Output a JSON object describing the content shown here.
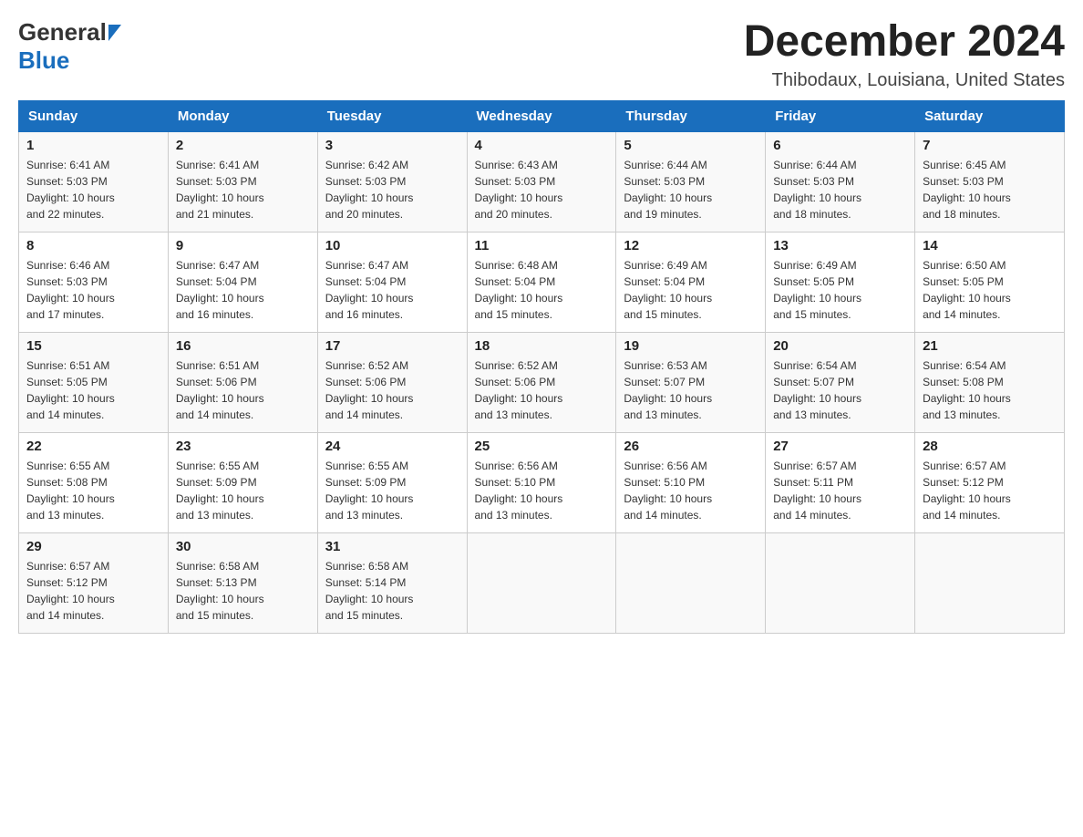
{
  "header": {
    "logo_general": "General",
    "logo_blue": "Blue",
    "month_title": "December 2024",
    "location": "Thibodaux, Louisiana, United States"
  },
  "weekdays": [
    "Sunday",
    "Monday",
    "Tuesday",
    "Wednesday",
    "Thursday",
    "Friday",
    "Saturday"
  ],
  "weeks": [
    [
      {
        "day": "1",
        "sunrise": "6:41 AM",
        "sunset": "5:03 PM",
        "daylight": "10 hours and 22 minutes."
      },
      {
        "day": "2",
        "sunrise": "6:41 AM",
        "sunset": "5:03 PM",
        "daylight": "10 hours and 21 minutes."
      },
      {
        "day": "3",
        "sunrise": "6:42 AM",
        "sunset": "5:03 PM",
        "daylight": "10 hours and 20 minutes."
      },
      {
        "day": "4",
        "sunrise": "6:43 AM",
        "sunset": "5:03 PM",
        "daylight": "10 hours and 20 minutes."
      },
      {
        "day": "5",
        "sunrise": "6:44 AM",
        "sunset": "5:03 PM",
        "daylight": "10 hours and 19 minutes."
      },
      {
        "day": "6",
        "sunrise": "6:44 AM",
        "sunset": "5:03 PM",
        "daylight": "10 hours and 18 minutes."
      },
      {
        "day": "7",
        "sunrise": "6:45 AM",
        "sunset": "5:03 PM",
        "daylight": "10 hours and 18 minutes."
      }
    ],
    [
      {
        "day": "8",
        "sunrise": "6:46 AM",
        "sunset": "5:03 PM",
        "daylight": "10 hours and 17 minutes."
      },
      {
        "day": "9",
        "sunrise": "6:47 AM",
        "sunset": "5:04 PM",
        "daylight": "10 hours and 16 minutes."
      },
      {
        "day": "10",
        "sunrise": "6:47 AM",
        "sunset": "5:04 PM",
        "daylight": "10 hours and 16 minutes."
      },
      {
        "day": "11",
        "sunrise": "6:48 AM",
        "sunset": "5:04 PM",
        "daylight": "10 hours and 15 minutes."
      },
      {
        "day": "12",
        "sunrise": "6:49 AM",
        "sunset": "5:04 PM",
        "daylight": "10 hours and 15 minutes."
      },
      {
        "day": "13",
        "sunrise": "6:49 AM",
        "sunset": "5:05 PM",
        "daylight": "10 hours and 15 minutes."
      },
      {
        "day": "14",
        "sunrise": "6:50 AM",
        "sunset": "5:05 PM",
        "daylight": "10 hours and 14 minutes."
      }
    ],
    [
      {
        "day": "15",
        "sunrise": "6:51 AM",
        "sunset": "5:05 PM",
        "daylight": "10 hours and 14 minutes."
      },
      {
        "day": "16",
        "sunrise": "6:51 AM",
        "sunset": "5:06 PM",
        "daylight": "10 hours and 14 minutes."
      },
      {
        "day": "17",
        "sunrise": "6:52 AM",
        "sunset": "5:06 PM",
        "daylight": "10 hours and 14 minutes."
      },
      {
        "day": "18",
        "sunrise": "6:52 AM",
        "sunset": "5:06 PM",
        "daylight": "10 hours and 13 minutes."
      },
      {
        "day": "19",
        "sunrise": "6:53 AM",
        "sunset": "5:07 PM",
        "daylight": "10 hours and 13 minutes."
      },
      {
        "day": "20",
        "sunrise": "6:54 AM",
        "sunset": "5:07 PM",
        "daylight": "10 hours and 13 minutes."
      },
      {
        "day": "21",
        "sunrise": "6:54 AM",
        "sunset": "5:08 PM",
        "daylight": "10 hours and 13 minutes."
      }
    ],
    [
      {
        "day": "22",
        "sunrise": "6:55 AM",
        "sunset": "5:08 PM",
        "daylight": "10 hours and 13 minutes."
      },
      {
        "day": "23",
        "sunrise": "6:55 AM",
        "sunset": "5:09 PM",
        "daylight": "10 hours and 13 minutes."
      },
      {
        "day": "24",
        "sunrise": "6:55 AM",
        "sunset": "5:09 PM",
        "daylight": "10 hours and 13 minutes."
      },
      {
        "day": "25",
        "sunrise": "6:56 AM",
        "sunset": "5:10 PM",
        "daylight": "10 hours and 13 minutes."
      },
      {
        "day": "26",
        "sunrise": "6:56 AM",
        "sunset": "5:10 PM",
        "daylight": "10 hours and 14 minutes."
      },
      {
        "day": "27",
        "sunrise": "6:57 AM",
        "sunset": "5:11 PM",
        "daylight": "10 hours and 14 minutes."
      },
      {
        "day": "28",
        "sunrise": "6:57 AM",
        "sunset": "5:12 PM",
        "daylight": "10 hours and 14 minutes."
      }
    ],
    [
      {
        "day": "29",
        "sunrise": "6:57 AM",
        "sunset": "5:12 PM",
        "daylight": "10 hours and 14 minutes."
      },
      {
        "day": "30",
        "sunrise": "6:58 AM",
        "sunset": "5:13 PM",
        "daylight": "10 hours and 15 minutes."
      },
      {
        "day": "31",
        "sunrise": "6:58 AM",
        "sunset": "5:14 PM",
        "daylight": "10 hours and 15 minutes."
      },
      null,
      null,
      null,
      null
    ]
  ],
  "labels": {
    "sunrise": "Sunrise:",
    "sunset": "Sunset:",
    "daylight": "Daylight:"
  }
}
